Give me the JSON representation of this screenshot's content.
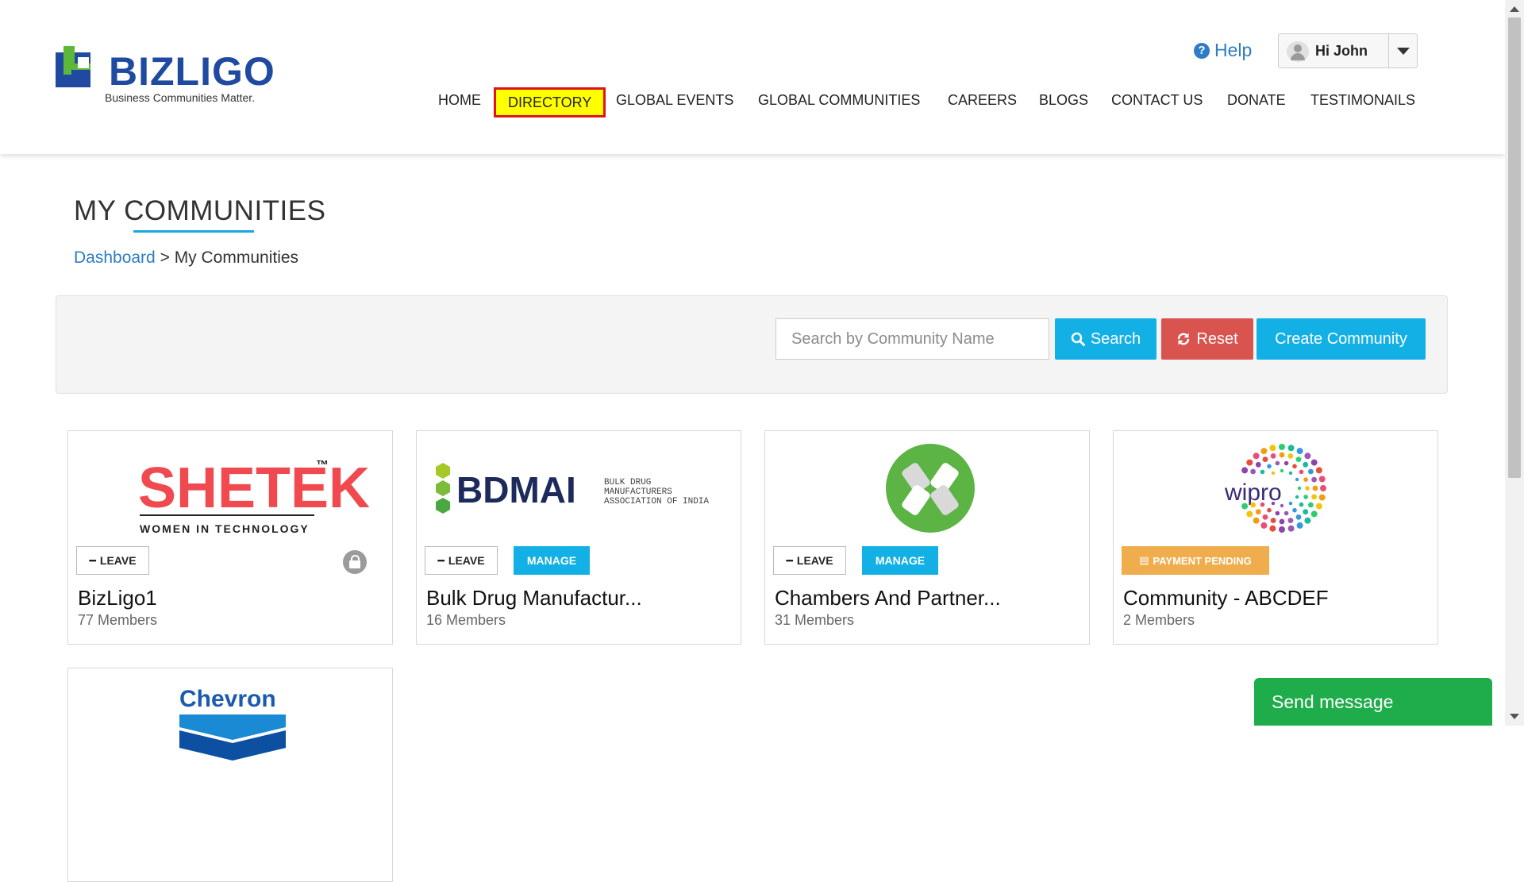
{
  "header": {
    "logo_text": "BIZLIGO",
    "logo_tagline": "Business Communities Matter.",
    "help_label": "Help",
    "user_greeting": "Hi John"
  },
  "nav": {
    "items": [
      "HOME",
      "DIRECTORY",
      "GLOBAL EVENTS",
      "GLOBAL COMMUNITIES",
      "CAREERS",
      "BLOGS",
      "CONTACT US",
      "DONATE",
      "TESTIMONAILS"
    ],
    "highlighted": "DIRECTORY"
  },
  "page": {
    "title": "MY COMMUNITIES",
    "breadcrumb_link": "Dashboard",
    "breadcrumb_separator": ">",
    "breadcrumb_current": "My Communities"
  },
  "toolbar": {
    "search_placeholder": "Search by Community Name",
    "search_label": "Search",
    "reset_label": "Reset",
    "create_label": "Create Community"
  },
  "cards": [
    {
      "name": "BizLigo1",
      "members": "77 Members",
      "logo": "SHETEK",
      "logo_tm": "™",
      "logo_sub": "WOMEN IN TECHNOLOGY",
      "buttons": [
        "LEAVE"
      ],
      "locked": true
    },
    {
      "name": "Bulk Drug Manufactur...",
      "members": "16 Members",
      "logo": "BDMAI",
      "logo_sub1": "BULK DRUG",
      "logo_sub2": "MANUFACTURERS",
      "logo_sub3": "ASSOCIATION OF INDIA",
      "buttons": [
        "LEAVE",
        "MANAGE"
      ]
    },
    {
      "name": "Chambers And Partner...",
      "members": "31 Members",
      "buttons": [
        "LEAVE",
        "MANAGE"
      ]
    },
    {
      "name": "Community - ABCDEF",
      "members": "2 Members",
      "logo": "wipro",
      "buttons": [
        "PAYMENT PENDING"
      ]
    },
    {
      "logo": "Chevron"
    }
  ],
  "chat": {
    "label": "Send message"
  },
  "colors": {
    "accent": "#13b0e6",
    "danger": "#d9534f",
    "warning": "#f0ad4e",
    "chat": "#1fac4b",
    "link": "#2d7cc4"
  }
}
